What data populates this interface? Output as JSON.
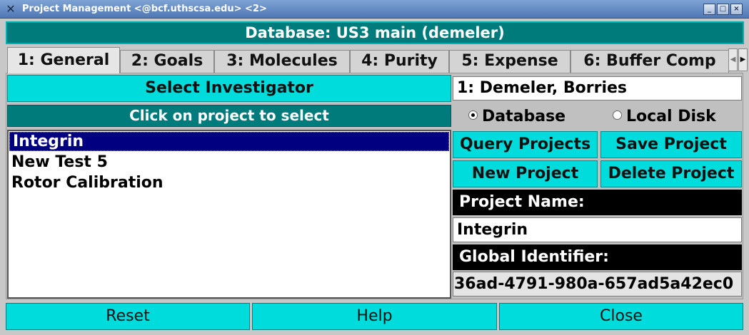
{
  "window": {
    "title": "Project Management <@bcf.uthscsa.edu> <2>",
    "buttons": {
      "minimize": "_",
      "maximize": "□",
      "close": "×"
    }
  },
  "banner": "Database: US3 main (demeler)",
  "tabs": [
    {
      "label": "1: General",
      "active": true
    },
    {
      "label": "2: Goals",
      "active": false
    },
    {
      "label": "3: Molecules",
      "active": false
    },
    {
      "label": "4: Purity",
      "active": false
    },
    {
      "label": "5: Expense",
      "active": false
    },
    {
      "label": "6: Buffer Comp",
      "active": false
    }
  ],
  "general": {
    "select_investigator_label": "Select Investigator",
    "investigator_value": "1: Demeler, Borries",
    "list_header": "Click on project to select",
    "source_options": [
      {
        "label": "Database",
        "selected": true
      },
      {
        "label": "Local Disk",
        "selected": false
      }
    ],
    "query_projects_label": "Query Projects",
    "save_project_label": "Save Project",
    "new_project_label": "New Project",
    "delete_project_label": "Delete Project",
    "project_name_label": "Project Name:",
    "project_name_value": "Integrin",
    "global_identifier_label": "Global Identifier:",
    "global_identifier_value": "36ad-4791-980a-657ad5a42ec0",
    "projects": [
      {
        "label": "Integrin",
        "selected": true
      },
      {
        "label": "New Test 5",
        "selected": false
      },
      {
        "label": "Rotor Calibration",
        "selected": false
      }
    ]
  },
  "footer": {
    "reset_label": "Reset",
    "help_label": "Help",
    "close_label": "Close"
  }
}
